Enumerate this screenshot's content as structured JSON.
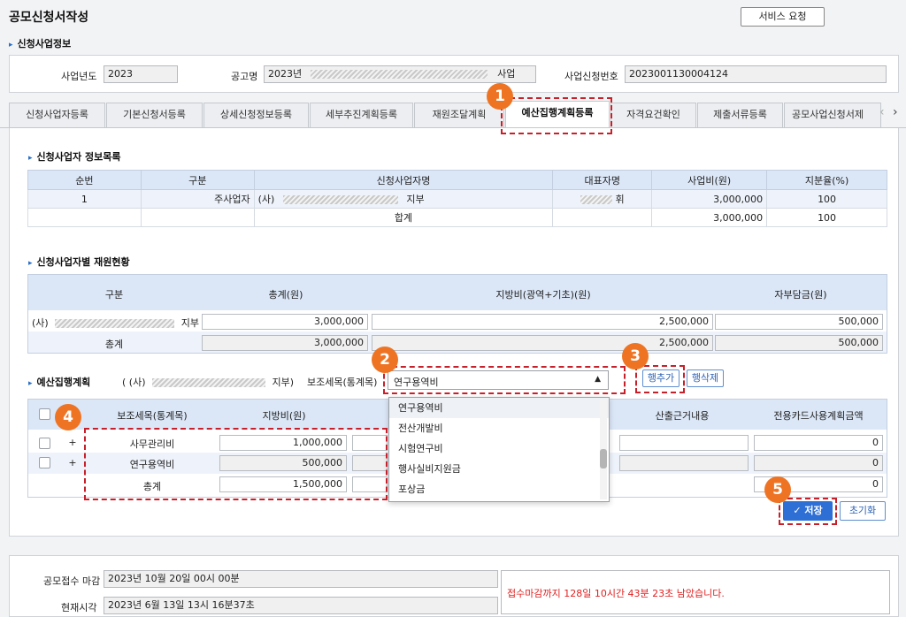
{
  "page": {
    "title": "공모신청서작성",
    "service_button": "서비스 요청"
  },
  "section_info": {
    "heading": "신청사업정보",
    "year_label": "사업년도",
    "year_value": "2023",
    "notice_label": "공고명",
    "notice_prefix": "2023년",
    "notice_suffix": "사업",
    "apply_no_label": "사업신청번호",
    "apply_no_value": "2023001130004124"
  },
  "tabs": [
    {
      "label": "신청사업자등록"
    },
    {
      "label": "기본신청서등록"
    },
    {
      "label": "상세신청정보등록"
    },
    {
      "label": "세부추진계획등록"
    },
    {
      "label": "재원조달계획"
    },
    {
      "label": "예산집행계획등록"
    },
    {
      "label": "자격요건확인"
    },
    {
      "label": "제출서류등록"
    },
    {
      "label": "공모사업신청서제"
    }
  ],
  "tab_nav": {
    "prev": "‹",
    "next": "›"
  },
  "applicants": {
    "heading": "신청사업자 정보목록",
    "headers": [
      "순번",
      "구분",
      "신청사업자명",
      "대표자명",
      "사업비(원)",
      "지분율(%)"
    ],
    "row": {
      "no": "1",
      "type": "주사업자",
      "name_prefix": "(사)",
      "name_suffix": "지부",
      "rep_suffix": "휘",
      "amount": "3,000,000",
      "share": "100"
    },
    "total": {
      "label": "합계",
      "amount": "3,000,000",
      "share": "100"
    }
  },
  "funding": {
    "heading": "신청사업자별 재원현황",
    "headers": [
      "구분",
      "총계(원)",
      "지방비(광역+기초)(원)",
      "자부담금(원)"
    ],
    "row": {
      "name_prefix": "(사)",
      "name_suffix": "지부",
      "total": "3,000,000",
      "local": "2,500,000",
      "self": "500,000"
    },
    "sum": {
      "label": "총계",
      "total": "3,000,000",
      "local": "2,500,000",
      "self": "500,000"
    }
  },
  "budget": {
    "heading": "예산집행계획",
    "org_prefix": "( (사)",
    "org_suffix": "지부)",
    "item_label": "보조세목(통계목)",
    "select_value": "연구용역비",
    "add_row": "행추가",
    "del_row": "행삭제",
    "headers": [
      "보조세목(통계목)",
      "지방비(원)",
      "산출근거내용",
      "전용카드사용계획금액"
    ],
    "rows": [
      {
        "plus": "+",
        "item": "사무관리비",
        "local": "1,000,000",
        "card": "0"
      },
      {
        "plus": "+",
        "item": "연구용역비",
        "local": "500,000",
        "card": "0"
      }
    ],
    "total": {
      "label": "총계",
      "local": "1,500,000",
      "card": "0"
    },
    "dropdown": [
      "연구용역비",
      "전산개발비",
      "시험연구비",
      "행사실비지원금",
      "포상금"
    ],
    "save": "저장",
    "reset": "초기화"
  },
  "footer": {
    "deadline_label": "공모접수 마감",
    "deadline_value": "2023년 10월 20일 00시 00분",
    "now_label": "현재시각",
    "now_value": "2023년 6월 13일 13시 16분37초",
    "remaining": "접수마감까지 128일 10시간 43분 23초 남았습니다."
  },
  "badges": [
    "1",
    "2",
    "3",
    "4",
    "5"
  ],
  "colors": {
    "accent": "#2a6fc9",
    "badge": "#ee7424",
    "annotation": "#c8202a",
    "header_bg": "#dbe7f7",
    "save_bg": "#2e6fd6",
    "warning_text": "#e02020"
  }
}
